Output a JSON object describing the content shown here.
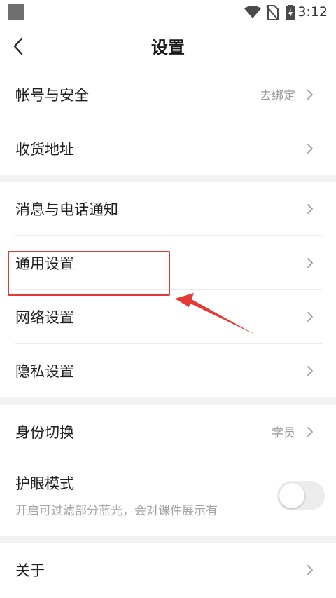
{
  "status_bar": {
    "time": "3:12",
    "icons": [
      "app-square-icon",
      "wifi-icon",
      "no-sim-icon",
      "battery-charging-icon"
    ]
  },
  "nav": {
    "back_icon": "chevron-left-icon",
    "title": "设置"
  },
  "groups": {
    "account": {
      "items": [
        {
          "label": "帐号与安全",
          "value": "去绑定"
        },
        {
          "label": "收货地址",
          "value": ""
        }
      ]
    },
    "general": {
      "items": [
        {
          "label": "消息与电话通知"
        },
        {
          "label": "通用设置"
        },
        {
          "label": "网络设置"
        },
        {
          "label": "隐私设置"
        }
      ]
    },
    "identity": {
      "switch_role": {
        "label": "身份切换",
        "value": "学员"
      },
      "eye_mode": {
        "label": "护眼模式",
        "description": "开启可过滤部分蓝光，会对课件展示有",
        "enabled": false
      }
    },
    "about": {
      "items": [
        {
          "label": "关于"
        }
      ]
    }
  },
  "colors": {
    "annotation_red": "#e53935",
    "section_gap": "#f2f2f2",
    "secondary_text": "#9a9a9a"
  }
}
